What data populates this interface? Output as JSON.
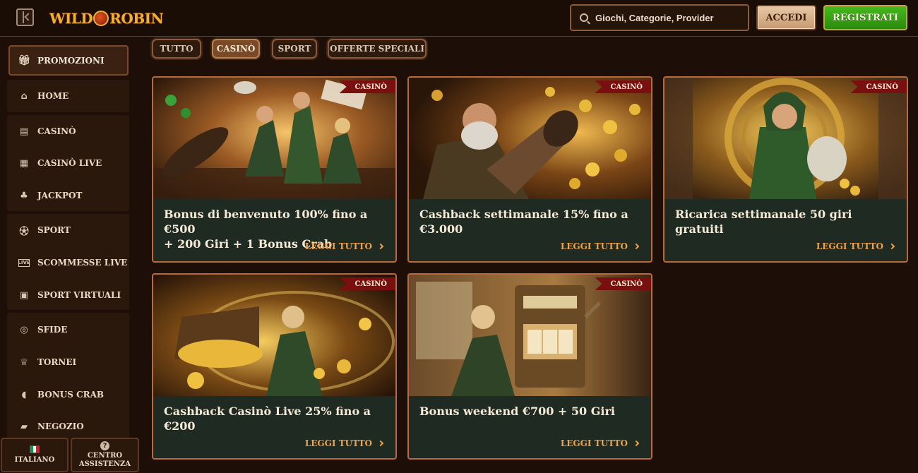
{
  "header": {
    "logo_text_left": "WILD",
    "logo_text_right": "ROBIN",
    "search_placeholder": "Giochi, Categorie, Provider",
    "login_label": "ACCEDI",
    "register_label": "REGISTRATI"
  },
  "sidebar": {
    "active": {
      "label": "PROMOZIONI",
      "icon": "gift-icon"
    },
    "items": [
      {
        "label": "HOME",
        "icon": "home-icon"
      },
      {
        "label": "CASINÒ",
        "icon": "casino-icon"
      },
      {
        "label": "CASINÒ LIVE",
        "icon": "live-cards-icon"
      },
      {
        "label": "JACKPOT",
        "icon": "clover-icon"
      },
      {
        "label": "SPORT",
        "icon": "football-icon"
      },
      {
        "label": "SCOMMESSE LIVE",
        "icon": "live-badge-icon"
      },
      {
        "label": "SPORT VIRTUALI",
        "icon": "virtual-sport-icon"
      },
      {
        "label": "SFIDE",
        "icon": "target-icon"
      },
      {
        "label": "TORNEI",
        "icon": "trophy-icon"
      },
      {
        "label": "BONUS CRAB",
        "icon": "crab-claw-icon"
      },
      {
        "label": "NEGOZIO",
        "icon": "shop-bag-icon"
      }
    ],
    "language_label": "ITALIANO",
    "help_label_line1": "CENTRO",
    "help_label_line2": "ASSISTENZA"
  },
  "filters": [
    {
      "label": "TUTTO",
      "active": false
    },
    {
      "label": "CASINÒ",
      "active": true
    },
    {
      "label": "SPORT",
      "active": false
    },
    {
      "label": "OFFERTE SPECIALI",
      "active": false
    }
  ],
  "promos": [
    {
      "badge": "CASINÒ",
      "title_line1": "Bonus di benvenuto 100% fino a €500",
      "title_line2": "+ 200 Giri + 1 Bonus Crab",
      "cta": "LEGGI TUTTO"
    },
    {
      "badge": "CASINÒ",
      "title_line1": "Cashback settimanale 15% fino a",
      "title_line2": "€3.000",
      "cta": "LEGGI TUTTO"
    },
    {
      "badge": "CASINÒ",
      "title_line1": "Ricarica settimanale 50 giri gratuiti",
      "title_line2": "",
      "cta": "LEGGI TUTTO"
    },
    {
      "badge": "CASINÒ",
      "title_line1": "Cashback Casinò Live 25% fino a",
      "title_line2": "€200",
      "cta": "LEGGI TUTTO"
    },
    {
      "badge": "CASINÒ",
      "title_line1": "Bonus weekend €700 + 50 Giri",
      "title_line2": "",
      "cta": "LEGGI TUTTO"
    }
  ],
  "colors": {
    "background": "#1d0f07",
    "card_body": "#1f2a22",
    "card_border": "#b86a3a",
    "cta": "#f0a24a",
    "badge": "#7a0f0f",
    "register_green": "#3aa016"
  }
}
